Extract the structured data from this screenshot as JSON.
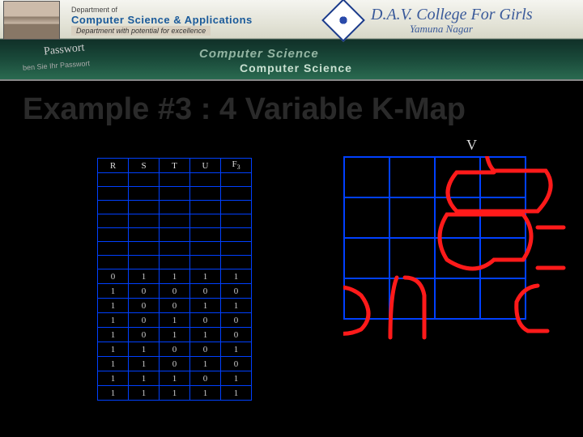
{
  "banner": {
    "dept_line1": "Department of",
    "dept_line2": "Computer Science & Applications",
    "dept_line3": "Department with potential for excellence",
    "college_line1": "D.A.V. College For Girls",
    "college_line2": "Yamuna Nagar",
    "passwort": "Passwort",
    "pwline": "ben Sie Ihr Passwort",
    "cs1": "Computer Science",
    "cs2": "Computer Science"
  },
  "title": "Example #3 : 4 Variable K-Map",
  "truth_table": {
    "headers": [
      "R",
      "S",
      "T",
      "U",
      "F3"
    ],
    "blank_rows": 7,
    "rows": [
      [
        "0",
        "1",
        "1",
        "1",
        "1"
      ],
      [
        "1",
        "0",
        "0",
        "0",
        "0"
      ],
      [
        "1",
        "0",
        "0",
        "1",
        "1"
      ],
      [
        "1",
        "0",
        "1",
        "0",
        "0"
      ],
      [
        "1",
        "0",
        "1",
        "1",
        "0"
      ],
      [
        "1",
        "1",
        "0",
        "0",
        "1"
      ],
      [
        "1",
        "1",
        "0",
        "1",
        "0"
      ],
      [
        "1",
        "1",
        "1",
        "0",
        "1"
      ],
      [
        "1",
        "1",
        "1",
        "1",
        "1"
      ]
    ]
  },
  "kmap": {
    "top_var": "V",
    "rows": 4,
    "cols": 4,
    "groups": [
      {
        "name": "group-a",
        "color": "#ff2020",
        "shape": "stroke",
        "desc": "red rounded group top-right extending off-map"
      },
      {
        "name": "group-b",
        "color": "#ff2020",
        "shape": "stroke",
        "desc": "red group center-right 2x2"
      },
      {
        "name": "group-c",
        "color": "#ff2020",
        "shape": "stroke",
        "desc": "red group bottom wrap corners"
      },
      {
        "name": "group-d",
        "color": "#ff2020",
        "shape": "stroke",
        "desc": "red vertical pair bottom-center"
      }
    ]
  },
  "chart_data": {
    "type": "table",
    "title": "4-variable truth table (partial) and K-map groupings",
    "columns": [
      "R",
      "S",
      "T",
      "U",
      "F3"
    ],
    "rows": [
      [
        0,
        1,
        1,
        1,
        1
      ],
      [
        1,
        0,
        0,
        0,
        0
      ],
      [
        1,
        0,
        0,
        1,
        1
      ],
      [
        1,
        0,
        1,
        0,
        0
      ],
      [
        1,
        0,
        1,
        1,
        0
      ],
      [
        1,
        1,
        0,
        0,
        1
      ],
      [
        1,
        1,
        0,
        1,
        0
      ],
      [
        1,
        1,
        1,
        0,
        1
      ],
      [
        1,
        1,
        1,
        1,
        1
      ]
    ]
  }
}
